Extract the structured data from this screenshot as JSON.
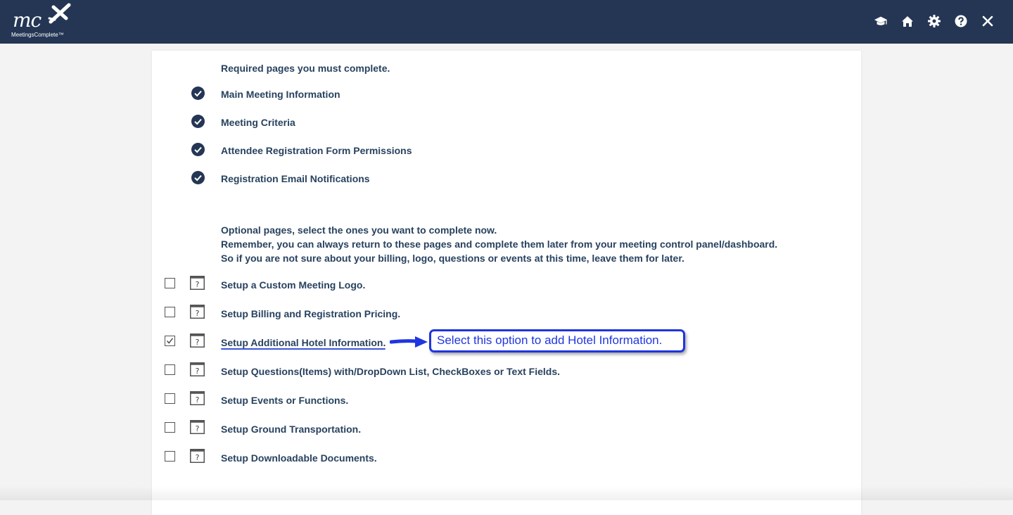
{
  "app": {
    "logo_text": "mc",
    "logo_subtext": "MeetingsComplete™"
  },
  "toolbar": {
    "icons": [
      "graduation-cap-icon",
      "home-icon",
      "gear-icon",
      "help-icon",
      "close-icon"
    ]
  },
  "required": {
    "heading": "Required pages you must complete.",
    "items": [
      {
        "label": "Main Meeting Information",
        "completed": true
      },
      {
        "label": "Meeting Criteria",
        "completed": true
      },
      {
        "label": "Attendee Registration Form Permissions",
        "completed": true
      },
      {
        "label": "Registration Email Notifications",
        "completed": true
      }
    ]
  },
  "optional": {
    "intro_line1": "Optional pages, select the ones you want to complete now.",
    "intro_line2": "Remember, you can always return to these pages and complete them later from your meeting control panel/dashboard.",
    "intro_line3": "So if you are not sure about your billing, logo, questions or events at this time, leave them for later.",
    "items": [
      {
        "label": "Setup a Custom Meeting Logo.",
        "checked": false
      },
      {
        "label": "Setup Billing and Registration Pricing.",
        "checked": false
      },
      {
        "label": "Setup Additional Hotel Information.",
        "checked": true
      },
      {
        "label": "Setup Questions(Items) with/DropDown List, CheckBoxes or Text Fields.",
        "checked": false
      },
      {
        "label": "Setup Events or Functions.",
        "checked": false
      },
      {
        "label": "Setup Ground Transportation.",
        "checked": false
      },
      {
        "label": "Setup Downloadable Documents.",
        "checked": false
      }
    ]
  },
  "annotation": {
    "callout_text": "Select this option to add Hotel Information."
  },
  "colors": {
    "header_bg": "#243654",
    "text": "#28425f",
    "annotation": "#1f35e0"
  }
}
